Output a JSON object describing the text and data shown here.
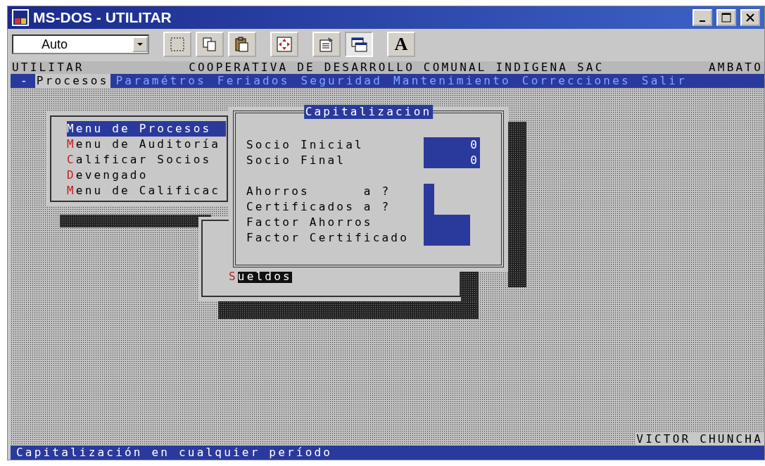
{
  "window": {
    "title": "MS-DOS - UTILITAR"
  },
  "toolbar": {
    "font_size": "Auto",
    "buttons": [
      {
        "kind": "mark"
      },
      {
        "kind": "copy"
      },
      {
        "kind": "paste"
      },
      {
        "kind": "fullscreen"
      },
      {
        "kind": "properties"
      },
      {
        "kind": "background",
        "selected": true
      },
      {
        "kind": "font",
        "label": "A"
      }
    ]
  },
  "dos": {
    "header": {
      "left": "UTILITAR",
      "center": "COOPERATIVA DE DESARROLLO COMUNAL INDIGENA SAC",
      "right": "AMBATO"
    },
    "system_menu": "-",
    "menubar": [
      {
        "label": "Procesos",
        "selected": true
      },
      {
        "label": "Paramétros",
        "selected": false
      },
      {
        "label": "Feriados",
        "selected": false
      },
      {
        "label": "Seguridad",
        "selected": false
      },
      {
        "label": "Mantenimiento",
        "selected": false
      },
      {
        "label": "Correcciones",
        "selected": false
      },
      {
        "label": "Salir",
        "selected": false
      }
    ],
    "process_menu": [
      {
        "label": "Menu de Procesos",
        "selected": true
      },
      {
        "label": "Menu de Auditoría",
        "selected": false
      },
      {
        "label": "Calificar Socios",
        "selected": false
      },
      {
        "label": "Devengado",
        "selected": false
      },
      {
        "label": "Menu de Calificac",
        "selected": false
      }
    ],
    "submenu": [
      {
        "label": "Sueldos",
        "selected": true
      }
    ],
    "dialog": {
      "title": "Capitalizacion",
      "fields": [
        {
          "label": "Socio Inicial",
          "kind": "wide",
          "value": "0"
        },
        {
          "label": "Socio Final",
          "kind": "wide",
          "value": "0"
        },
        {
          "kind": "gap"
        },
        {
          "label": "Ahorros      a ?",
          "kind": "narrow"
        },
        {
          "label": "Certificados a ?",
          "kind": "narrow"
        },
        {
          "label": "Factor Ahorros",
          "kind": "medium"
        },
        {
          "label": "Factor Certificado",
          "kind": "medium"
        }
      ]
    },
    "user": "VICTOR CHUNCHA",
    "status": "Capitalización en cualquier período"
  }
}
